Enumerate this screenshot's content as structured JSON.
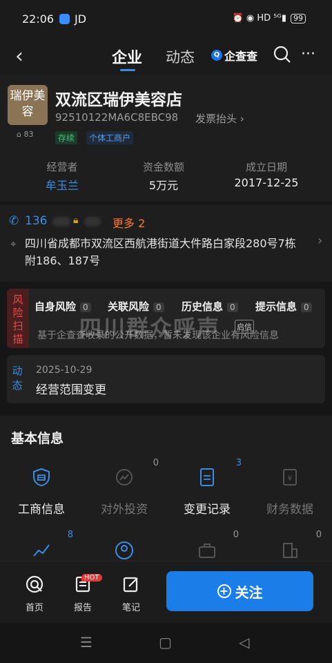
{
  "status_bar": {
    "time": "22:06",
    "app": "JD",
    "icons": "⏰ ◉ HD ⁵ᴳ▮",
    "battery": "99"
  },
  "nav": {
    "back": "‹",
    "tab_company": "企业",
    "tab_news": "动态",
    "brand": "企查查",
    "brand_logo": "Q",
    "more": "···"
  },
  "company": {
    "logo_text": "瑞伊美容",
    "views": "83",
    "name": "双流区瑞伊美容店",
    "credit_code": "92510122MA6C8EBC98",
    "invoice": "发票抬头 ›",
    "tags": [
      "存续",
      "个体工商户"
    ],
    "operator_label": "经营者",
    "operator": "牟玉兰",
    "capital_label": "资金数额",
    "capital": "5万元",
    "date_label": "成立日期",
    "date": "2017-12-25"
  },
  "contact": {
    "phone": "136",
    "more": "更多 2",
    "address": "四川省成都市双流区西航港街道大件路白家段280号7栋附186、187号"
  },
  "risk": {
    "side": "风险扫描",
    "items": [
      {
        "label": "自身风险",
        "count": "0"
      },
      {
        "label": "关联风险",
        "count": "0"
      },
      {
        "label": "历史信息",
        "count": "0"
      },
      {
        "label": "提示信息",
        "count": "0"
      }
    ],
    "desc": "基于企查查收录的公开数据，暂未发现该企业有风险信息",
    "badge": "启信",
    "watermark": "四川群众呼声"
  },
  "dynamic": {
    "side": "动态",
    "date": "2025-10-29",
    "text": "经营范围变更"
  },
  "basic": {
    "title": "基本信息",
    "cells": [
      {
        "label": "工商信息",
        "count": ""
      },
      {
        "label": "对外投资",
        "count": "0"
      },
      {
        "label": "变更记录",
        "count": "3"
      },
      {
        "label": "财务数据",
        "count": ""
      }
    ],
    "row2_counts": [
      "8",
      "",
      "0",
      "0"
    ]
  },
  "bottom": {
    "home": "首页",
    "report": "报告",
    "hot": "HOT",
    "notes": "笔记",
    "follow": "关注"
  },
  "colors": {
    "accent": "#1a7de8",
    "danger": "#e0504a",
    "success": "#45c07a",
    "warning": "#ff7a2e"
  }
}
